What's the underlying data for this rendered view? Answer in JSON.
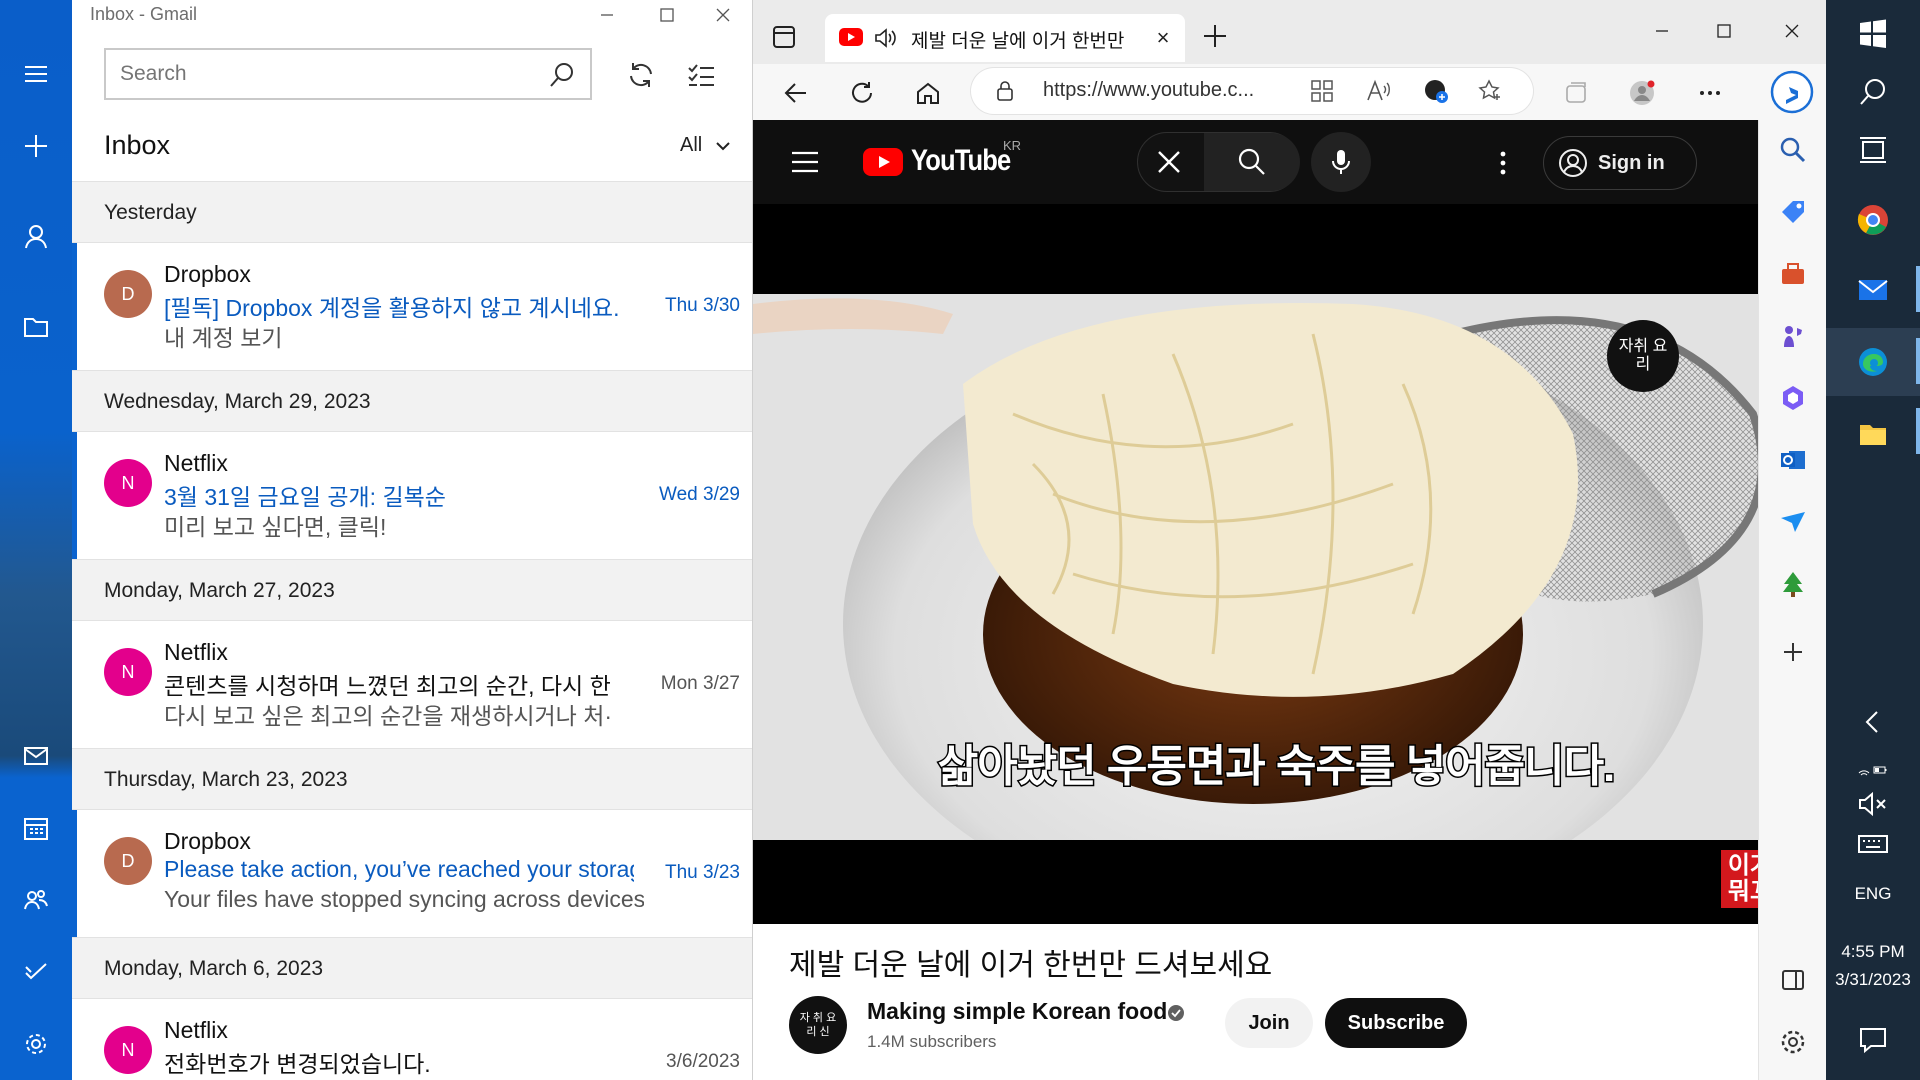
{
  "mail": {
    "window_title": "Inbox - Gmail",
    "search_placeholder": "Search",
    "folder_title": "Inbox",
    "filter_label": "All",
    "groups": [
      {
        "date": "Yesterday",
        "messages": [
          {
            "avatar": "D",
            "avatar_color": "#b86a4f",
            "sender": "Dropbox",
            "subject": "[필독] Dropbox 계정을 활용하지 않고 계시네요.",
            "preview": "내 계정 보기",
            "date": "Thu 3/30",
            "unread": true
          }
        ]
      },
      {
        "date": "Wednesday, March 29, 2023",
        "messages": [
          {
            "avatar": "N",
            "avatar_color": "#e3008c",
            "sender": "Netflix",
            "subject": "3월 31일 금요일 공개: 길복순",
            "preview": "미리 보고 싶다면, 클릭!",
            "date": "Wed 3/29",
            "unread": true
          }
        ]
      },
      {
        "date": "Monday, March 27, 2023",
        "messages": [
          {
            "avatar": "N",
            "avatar_color": "#e3008c",
            "sender": "Netflix",
            "subject": "콘텐츠를 시청하며 느꼈던 최고의 순간, 다시 한",
            "preview": "다시 보고 싶은 최고의 순간을 재생하시거나 처·",
            "date": "Mon 3/27",
            "unread": false
          }
        ]
      },
      {
        "date": "Thursday, March 23, 2023",
        "messages": [
          {
            "avatar": "D",
            "avatar_color": "#b86a4f",
            "sender": "Dropbox",
            "subject": "Please take action, you’ve reached your storage",
            "preview": "Your files have stopped syncing across devices",
            "date": "Thu 3/23",
            "unread": true
          }
        ]
      },
      {
        "date": "Monday, March 6, 2023",
        "messages": [
          {
            "avatar": "N",
            "avatar_color": "#e3008c",
            "sender": "Netflix",
            "subject": "전화번호가 변경되었습니다.",
            "preview": "",
            "date": "3/6/2023",
            "unread": false
          }
        ]
      }
    ]
  },
  "browser": {
    "tab_title": "제발 더운 날에 이거 한번만",
    "url": "https://www.youtube.c...",
    "youtube": {
      "brand": "YouTube",
      "region": "KR",
      "sign_in": "Sign in",
      "channel_bug": "자취 요리",
      "subtitle": "삶아놨던 우동면과 숙주를 넣어줍니다.",
      "corner_stamp": "이거 뭐꼬",
      "video_title": "제발 더운 날에 이거 한번만 드셔보세요",
      "channel_avatar_text": "자 취 요 리 신",
      "channel_name": "Making simple Korean food",
      "subscribers": "1.4M subscribers",
      "join": "Join",
      "subscribe": "Subscribe"
    }
  },
  "taskbar": {
    "language": "ENG",
    "time": "4:55 PM",
    "date": "3/31/2023"
  }
}
